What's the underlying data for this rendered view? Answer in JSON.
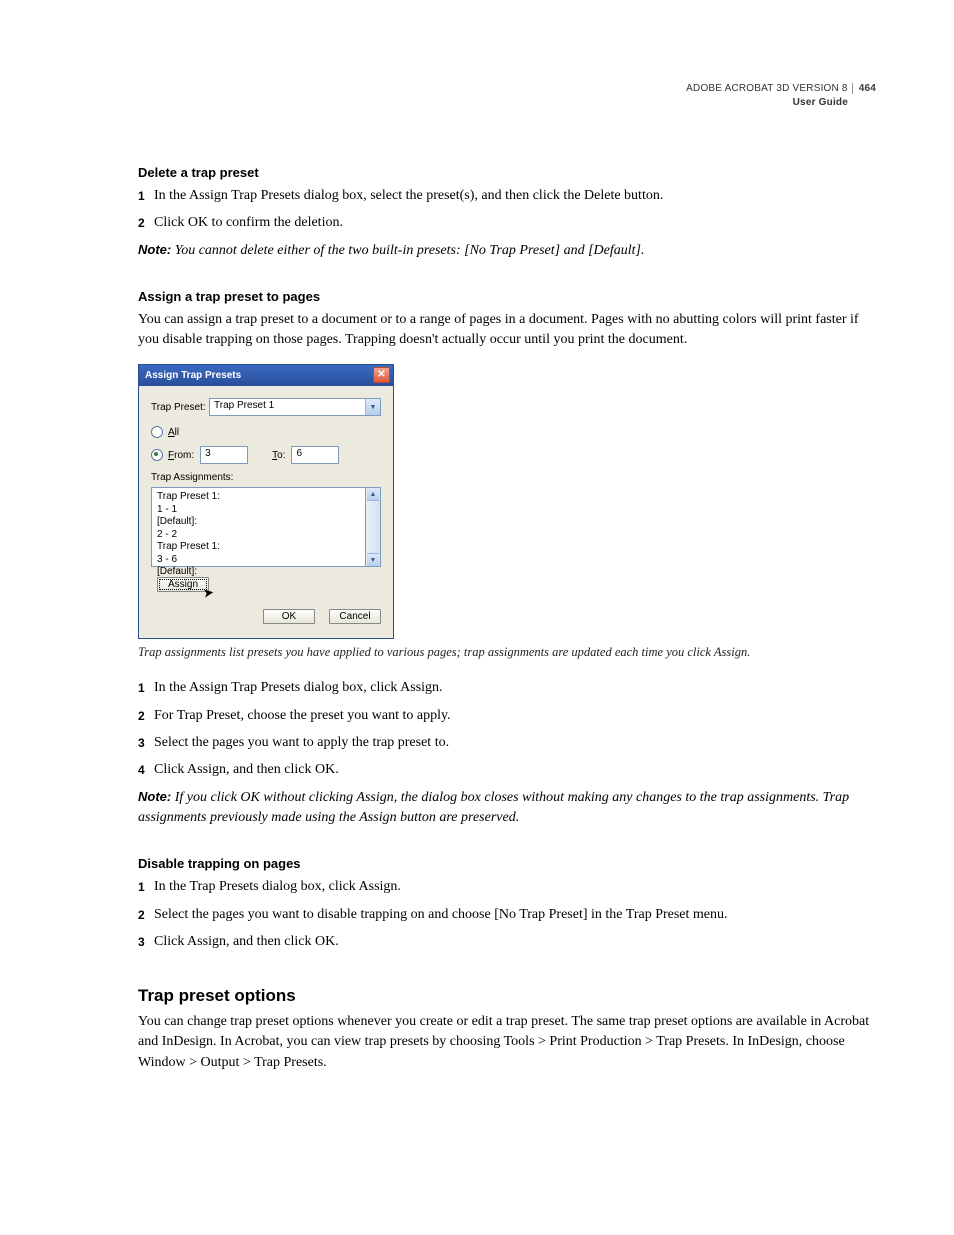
{
  "header": {
    "product": "ADOBE ACROBAT 3D VERSION 8",
    "doc": "User Guide",
    "page": "464"
  },
  "s1": {
    "title": "Delete a trap preset",
    "step1": "In the Assign Trap Presets dialog box, select the preset(s), and then click the Delete button.",
    "step2": "Click OK to confirm the deletion.",
    "noteLabel": "Note:",
    "noteText": "You cannot delete either of the two built-in presets: [No Trap Preset] and [Default]."
  },
  "s2": {
    "title": "Assign a trap preset to pages",
    "intro": "You can assign a trap preset to a document or to a range of pages in a document. Pages with no abutting colors will print faster if you disable trapping on those pages. Trapping doesn't actually occur until you print the document.",
    "caption": "Trap assignments list presets you have applied to various pages; trap assignments are updated each time you click Assign.",
    "step1": "In the Assign Trap Presets dialog box, click Assign.",
    "step2": "For Trap Preset, choose the preset you want to apply.",
    "step3": "Select the pages you want to apply the trap preset to.",
    "step4": "Click Assign, and then click OK.",
    "noteLabel": "Note:",
    "noteText": "If you click OK without clicking Assign, the dialog box closes without making any changes to the trap assignments. Trap assignments previously made using the Assign button are preserved."
  },
  "dialog": {
    "title": "Assign Trap Presets",
    "trapPresetLabel": "Trap Preset:",
    "trapPresetValue": "Trap Preset 1",
    "allLabel": "All",
    "fromLabel": "From:",
    "fromValue": "3",
    "toLabel": "To:",
    "toValue": "6",
    "assignmentsLabel": "Trap Assignments:",
    "list": {
      "l1": "Trap Preset 1:",
      "l2": "1 - 1",
      "l3": "[Default]:",
      "l4": "2 - 2",
      "l5": "Trap Preset 1:",
      "l6": "3 - 6",
      "l7": "[Default]:"
    },
    "assignBtn": "Assign",
    "okBtn": "OK",
    "cancelBtn": "Cancel"
  },
  "s3": {
    "title": "Disable trapping on pages",
    "step1": "In the Trap Presets dialog box, click Assign.",
    "step2": "Select the pages you want to disable trapping on and choose [No Trap Preset] in the Trap Preset menu.",
    "step3": "Click Assign, and then click OK."
  },
  "s4": {
    "title": "Trap preset options",
    "body": "You can change trap preset options whenever you create or edit a trap preset. The same trap preset options are available in Acrobat and InDesign. In Acrobat, you can view trap presets by choosing Tools > Print Production > Trap Presets. In InDesign, choose Window > Output > Trap Presets."
  }
}
